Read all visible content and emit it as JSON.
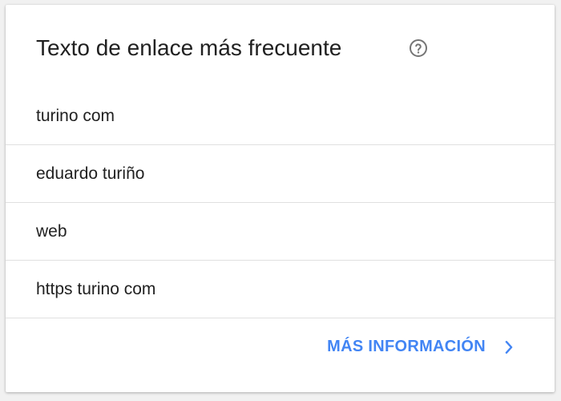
{
  "card": {
    "title": "Texto de enlace más frecuente",
    "help_icon": "help-circle-icon",
    "items": [
      {
        "label": "turino com"
      },
      {
        "label": "eduardo turiño"
      },
      {
        "label": "web"
      },
      {
        "label": "https turino com"
      }
    ],
    "more_link": {
      "label": "MÁS INFORMACIÓN",
      "icon": "chevron-right-icon"
    }
  },
  "colors": {
    "accent": "#4285f4",
    "text": "#212121",
    "divider": "#e0e0e0",
    "icon": "#757575"
  }
}
